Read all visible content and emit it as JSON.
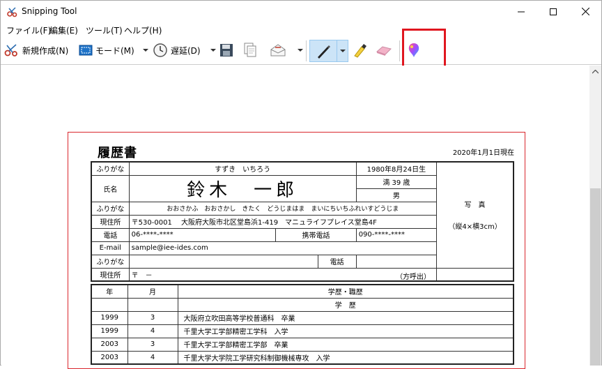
{
  "window": {
    "title": "Snipping Tool",
    "minimize_glyph": "—",
    "maximize_glyph": "☐",
    "close_glyph": "✕"
  },
  "menu": [
    "ファイル(F)",
    "編集(E)",
    "ツール(T)",
    "ヘルプ(H)"
  ],
  "toolbar": {
    "new_label": "新規作成(N)",
    "mode_label": "モード(M)",
    "delay_label": "遅延(D)"
  },
  "resume": {
    "title": "履歴書",
    "date": "2020年1月1日現在",
    "furigana_label": "ふりがな",
    "name_furigana": "すずき　いちろう",
    "birth": "1980年8月24日生",
    "name_label": "氏名",
    "name": "鈴木　一郎",
    "age": "満 39 歳",
    "gender": "男",
    "photo_line1": "写　真",
    "photo_line2": "（縦4×横3cm）",
    "address_furigana": "おおさかふ　おおさかし　きたく　どうじまはま　まいにちいちふれいすどうじま",
    "address_label": "現住所",
    "address": "〒530-0001　 大阪府大阪市北区堂島浜1-419　マニュライフプレイス堂島4F",
    "phone_label": "電話",
    "phone": "06-****-****",
    "mobile_label": "携帯電話",
    "mobile": "090-****-****",
    "email_label": "E-mail",
    "email": "sample@iee-ides.com",
    "contact_furigana_label": "ふりがな",
    "contact_phone_label": "電話",
    "contact_address_label": "現住所",
    "contact_address": "〒　－",
    "contact_note": "（方呼出）"
  },
  "history": {
    "year_header": "年",
    "month_header": "月",
    "section_header": "学歴・職歴",
    "subheader": "学　歴",
    "rows": [
      {
        "year": "1999",
        "month": "3",
        "text": "大阪府立吹田高等学校普通科　卒業"
      },
      {
        "year": "1999",
        "month": "4",
        "text": "千里大学工学部精密工学科　入学"
      },
      {
        "year": "2003",
        "month": "3",
        "text": "千里大学工学部精密工学部　卒業"
      },
      {
        "year": "2003",
        "month": "4",
        "text": "千里大学大学院工学研究科制御機械専攻　入学"
      }
    ]
  },
  "colors": {
    "highlight": "#e0161f",
    "snip_border": "#d9262c",
    "pen_active": "#cce4f7"
  }
}
